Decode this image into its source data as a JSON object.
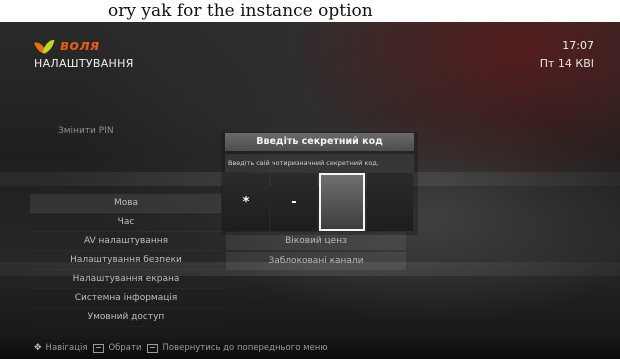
{
  "caption": "ory yak for the instance option",
  "header": {
    "brand": "воля",
    "title": "НАЛАШТУВАННЯ",
    "time": "17:07",
    "date": "Пт 14 КВІ"
  },
  "change_pin_label": "Змінити PIN",
  "menu": {
    "items": [
      {
        "label": "Мова"
      },
      {
        "label": "Час"
      },
      {
        "label": "AV налаштування"
      },
      {
        "label": "Налаштування безпеки"
      },
      {
        "label": "Налаштування екрана"
      },
      {
        "label": "Системна інформація"
      },
      {
        "label": "Умовний доступ"
      }
    ]
  },
  "options": {
    "items": [
      {
        "label": "Віковий ценз"
      },
      {
        "label": "Заблоковані канали"
      }
    ]
  },
  "dialog": {
    "title": "Введіть секретний код",
    "message": "Введіть свій чотиризначний секретний код.",
    "pin_cells": [
      "*",
      "-",
      "",
      ""
    ],
    "active_cell": 2
  },
  "footer": {
    "nav_label": "Навігація",
    "select_label": "Обрати",
    "back_label": "Повернутись до попереднього меню"
  },
  "colors": {
    "brand_orange": "#e25d1b",
    "brand_green": "#c4d42a",
    "dialog_title_bg": "#5a5a5a",
    "active_cell_border": "#f5f5f5"
  }
}
